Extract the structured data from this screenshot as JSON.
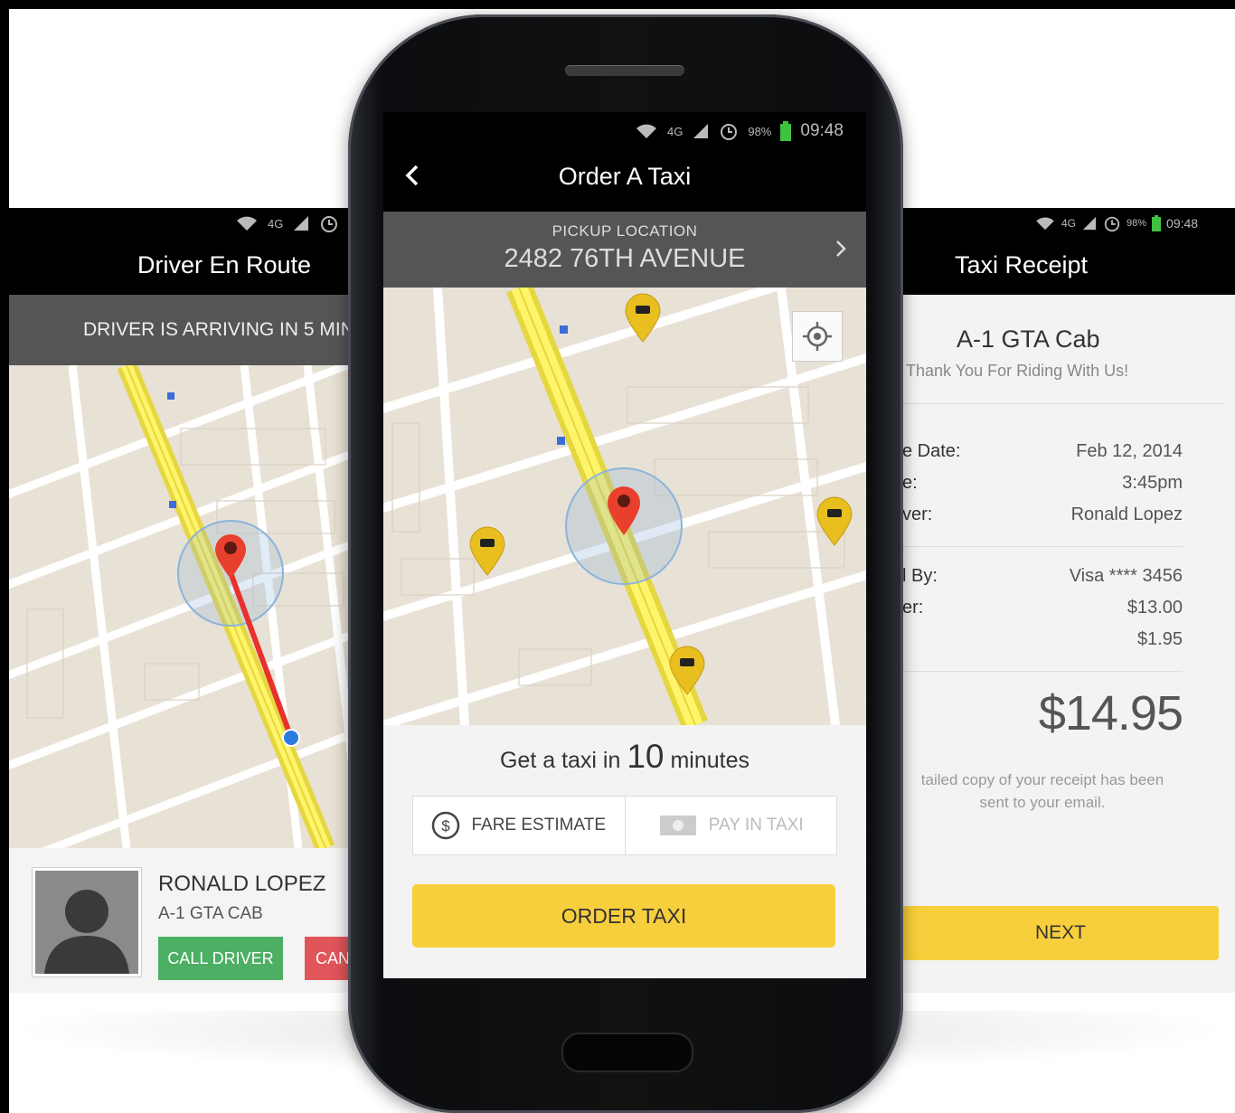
{
  "left_screen": {
    "status_icons": [
      "wifi-icon",
      "4g-icon",
      "signal-icon",
      "alarm-icon"
    ],
    "status_4g": "4G",
    "title": "Driver En Route",
    "banner": "DRIVER IS ARRIVING IN 5 MIN",
    "driver": {
      "name": "RONALD LOPEZ",
      "company": "A-1 GTA CAB",
      "call_label": "CALL DRIVER",
      "cancel_label": "CANCEL"
    }
  },
  "main_screen": {
    "status": {
      "network": "4G",
      "battery": "98%",
      "time": "09:48"
    },
    "title": "Order A Taxi",
    "pickup": {
      "label": "PICKUP LOCATION",
      "value": "2482 76TH AVENUE"
    },
    "eta": {
      "prefix": "Get a taxi in",
      "minutes": "10",
      "suffix": "minutes"
    },
    "payment_options": [
      {
        "label": "FARE ESTIMATE",
        "icon": "dollar-coin-icon",
        "active": true
      },
      {
        "label": "PAY IN TAXI",
        "icon": "cash-icon",
        "active": false
      }
    ],
    "order_label": "ORDER TAXI"
  },
  "right_screen": {
    "status": {
      "network": "4G",
      "battery": "98%",
      "time": "09:48"
    },
    "title": "Taxi Receipt",
    "company": "A-1 GTA Cab",
    "thanks": "Thank You For Riding With Us!",
    "rows": [
      {
        "label": "e Date:",
        "value": "Feb 12, 2014"
      },
      {
        "label": "e:",
        "value": "3:45pm"
      },
      {
        "label": "ver:",
        "value": "Ronald Lopez"
      },
      {
        "label": "l By:",
        "value": "Visa **** 3456"
      },
      {
        "label": "er:",
        "value": "$13.00"
      },
      {
        "label": "",
        "value": "$1.95"
      }
    ],
    "total": "$14.95",
    "note_line1": "tailed copy of your receipt has been",
    "note_line2": "sent to your email.",
    "next_label": "NEXT"
  },
  "colors": {
    "accent_yellow": "#f7cf3c",
    "call_green": "#4caf63",
    "cancel_red": "#e0555a",
    "banner_gray": "#555555",
    "route_red": "#e8302c"
  }
}
